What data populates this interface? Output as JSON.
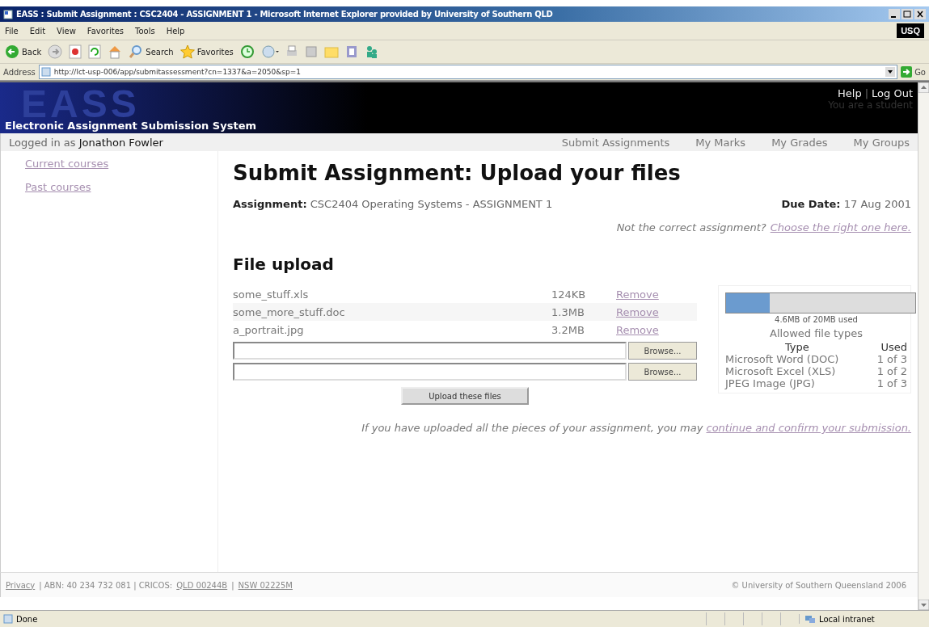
{
  "window": {
    "title": "EASS : Submit Assignment : CSC2404 - ASSIGNMENT 1 - Microsoft Internet Explorer provided by University of Southern QLD",
    "logo": "USQ"
  },
  "menu": [
    "File",
    "Edit",
    "View",
    "Favorites",
    "Tools",
    "Help"
  ],
  "toolbar": {
    "back": "Back",
    "search": "Search",
    "favorites": "Favorites"
  },
  "address": {
    "label": "Address",
    "value": "http://lct-usp-006/app/submitassessment?cn=1337&a=2050&sp=1",
    "go": "Go"
  },
  "header": {
    "logo": "EASS",
    "system": "Electronic Assignment Submission System",
    "links": [
      "Help",
      "Log Out"
    ],
    "separator": "|",
    "role": "You are a student"
  },
  "navbar": {
    "logged_in_label": "Logged in as",
    "user": "Jonathon Fowler",
    "items": [
      "Submit Assignments",
      "My Marks",
      "My Grades",
      "My Groups"
    ]
  },
  "sidebar": {
    "items": [
      "Current courses",
      "Past courses"
    ]
  },
  "main": {
    "title": "Submit Assignment: Upload your files",
    "assignment_label": "Assignment:",
    "assignment": "CSC2404 Operating Systems - ASSIGNMENT 1",
    "due_label": "Due Date:",
    "due": "17 Aug 2001",
    "wrong_prompt": "Not the correct assignment?",
    "wrong_link": "Choose the right one here.",
    "section": "File upload",
    "files": [
      {
        "name": "some_stuff.xls",
        "size": "124KB",
        "action": "Remove"
      },
      {
        "name": "some_more_stuff.doc",
        "size": "1.3MB",
        "action": "Remove"
      },
      {
        "name": "a_portrait.jpg",
        "size": "3.2MB",
        "action": "Remove"
      }
    ],
    "browse": [
      "Browse...",
      "Browse..."
    ],
    "upload_button": "Upload these files",
    "quota": {
      "level": 0.23,
      "reading": "4.6MB of 20MB used",
      "types_title": "Allowed file types",
      "columns": [
        "Type",
        "Used"
      ],
      "rows": [
        {
          "type": "Microsoft Word (DOC)",
          "used": "1 of 3"
        },
        {
          "type": "Microsoft Excel (XLS)",
          "used": "1 of 2"
        },
        {
          "type": "JPEG Image (JPG)",
          "used": "1 of 3"
        }
      ]
    },
    "confirm_text": "If you have uploaded all the pieces of your assignment, you may",
    "confirm_link": "continue and confirm your submission."
  },
  "footer": {
    "left": [
      {
        "kind": "link",
        "text": "Privacy"
      },
      {
        "kind": "text",
        "text": "| ABN: 40 234 732 081 | CRICOS:"
      },
      {
        "kind": "link",
        "text": "QLD 00244B"
      },
      {
        "kind": "text",
        "text": "|"
      },
      {
        "kind": "link",
        "text": "NSW 02225M"
      }
    ],
    "right": "© University of Southern Queensland 2006"
  },
  "status_bar": {
    "left": "Done",
    "zone": "Local intranet"
  }
}
